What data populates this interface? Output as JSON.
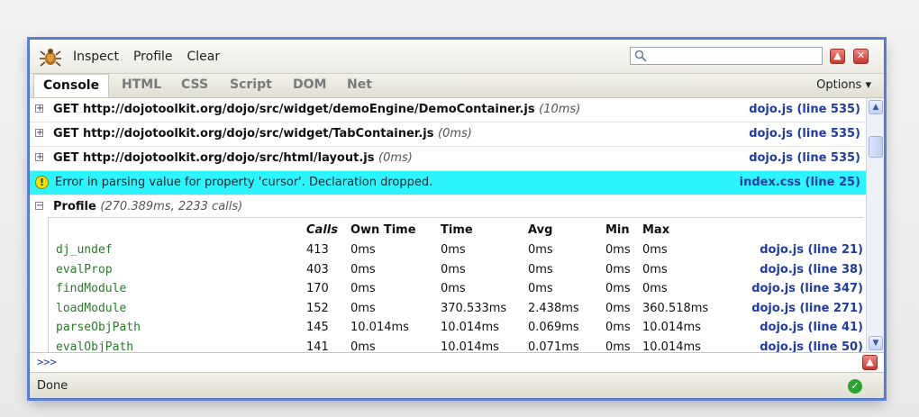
{
  "toolbar": {
    "menu": [
      "Inspect",
      "Profile",
      "Clear"
    ],
    "search_placeholder": ""
  },
  "tabs": [
    "Console",
    "HTML",
    "CSS",
    "Script",
    "DOM",
    "Net"
  ],
  "active_tab": "Console",
  "options_label": "Options ▾",
  "log": [
    {
      "text": "GET http://dojotoolkit.org/dojo/src/widget/demoEngine/DemoContainer.js",
      "time": "(10ms)",
      "source": "dojo.js (line 535)"
    },
    {
      "text": "GET http://dojotoolkit.org/dojo/src/widget/TabContainer.js",
      "time": "(0ms)",
      "source": "dojo.js (line 535)"
    },
    {
      "text": "GET http://dojotoolkit.org/dojo/src/html/layout.js",
      "time": "(0ms)",
      "source": "dojo.js (line 535)"
    }
  ],
  "error": {
    "message": "Error in parsing value for property 'cursor'. Declaration dropped.",
    "source": "index.css (line 25)"
  },
  "profile": {
    "title": "Profile",
    "summary": "(270.389ms, 2233 calls)",
    "headers": [
      "Calls",
      "Own Time",
      "Time",
      "Avg",
      "Min",
      "Max"
    ],
    "rows": [
      {
        "fn": "dj_undef",
        "calls": "413",
        "own": "0ms",
        "time": "0ms",
        "avg": "0ms",
        "min": "0ms",
        "max": "0ms",
        "source": "dojo.js (line 21)"
      },
      {
        "fn": "evalProp",
        "calls": "403",
        "own": "0ms",
        "time": "0ms",
        "avg": "0ms",
        "min": "0ms",
        "max": "0ms",
        "source": "dojo.js (line 38)"
      },
      {
        "fn": "findModule",
        "calls": "170",
        "own": "0ms",
        "time": "0ms",
        "avg": "0ms",
        "min": "0ms",
        "max": "0ms",
        "source": "dojo.js (line 347)"
      },
      {
        "fn": "loadModule",
        "calls": "152",
        "own": "0ms",
        "time": "370.533ms",
        "avg": "2.438ms",
        "min": "0ms",
        "max": "360.518ms",
        "source": "dojo.js (line 271)"
      },
      {
        "fn": "parseObjPath",
        "calls": "145",
        "own": "10.014ms",
        "time": "10.014ms",
        "avg": "0.069ms",
        "min": "0ms",
        "max": "10.014ms",
        "source": "dojo.js (line 41)"
      },
      {
        "fn": "evalObjPath",
        "calls": "141",
        "own": "0ms",
        "time": "10.014ms",
        "avg": "0.071ms",
        "min": "0ms",
        "max": "10.014ms",
        "source": "dojo.js (line 50)"
      }
    ]
  },
  "command_prompt": ">>>",
  "status": "Done"
}
